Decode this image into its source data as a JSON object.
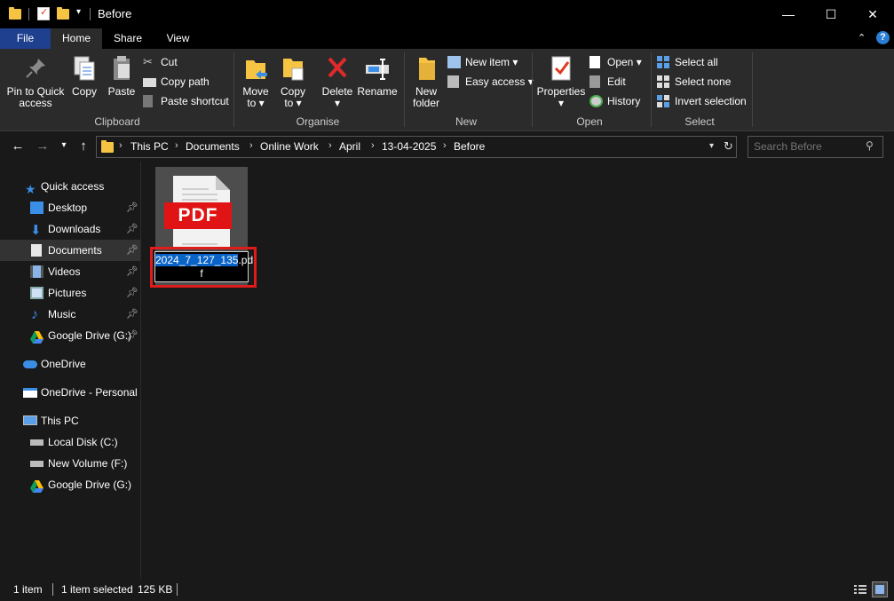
{
  "window": {
    "title": "Before",
    "minimize": "—",
    "maximize": "☐",
    "close": "✕"
  },
  "ribbon_tabs": [
    "File",
    "Home",
    "Share",
    "View"
  ],
  "ribbon": {
    "clipboard": {
      "label": "Clipboard",
      "pin": "Pin to Quick access",
      "pin_l1": "Pin to Quick",
      "pin_l2": "access",
      "copy": "Copy",
      "paste": "Paste",
      "cut": "Cut",
      "copy_path": "Copy path",
      "paste_shortcut": "Paste shortcut"
    },
    "organise": {
      "label": "Organise",
      "move_to": "Move",
      "move_to2": "to",
      "copy_to": "Copy",
      "copy_to2": "to",
      "delete": "Delete",
      "rename": "Rename"
    },
    "new": {
      "label": "New",
      "new_folder": "New",
      "new_folder2": "folder",
      "new_item": "New item",
      "easy_access": "Easy access"
    },
    "open": {
      "label": "Open",
      "properties": "Properties",
      "open": "Open",
      "edit": "Edit",
      "history": "History"
    },
    "select": {
      "label": "Select",
      "select_all": "Select all",
      "select_none": "Select none",
      "invert": "Invert selection"
    }
  },
  "breadcrumb": [
    "This PC",
    "Documents",
    "Online Work",
    "April",
    "13-04-2025",
    "Before"
  ],
  "search": {
    "placeholder": "Search Before"
  },
  "nav": {
    "quick_access": "Quick access",
    "quick_items": [
      "Desktop",
      "Downloads",
      "Documents",
      "Videos",
      "Pictures",
      "Music",
      "Google Drive (G:)"
    ],
    "onedrive": "OneDrive",
    "onedrive_personal": "OneDrive - Personal",
    "this_pc": "This PC",
    "pc_items": [
      "Local Disk (C:)",
      "New Volume (F:)",
      "Google Drive (G:)"
    ]
  },
  "file": {
    "badge": "PDF",
    "name_selected": "2024_7_127_135",
    "name_ext1": ".pd",
    "name_ext2": "f"
  },
  "status": {
    "items": "1 item",
    "selected": "1 item selected",
    "size": "125 KB"
  }
}
